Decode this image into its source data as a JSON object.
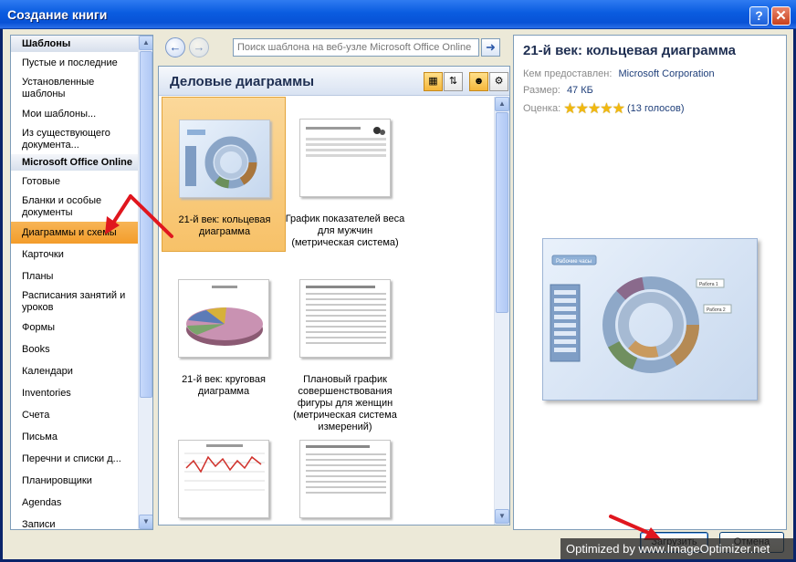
{
  "window": {
    "title": "Создание книги",
    "help_label": "?",
    "close_label": "✕"
  },
  "nav": {
    "items": [
      {
        "label": "Шаблоны",
        "type": "header"
      },
      {
        "label": "Пустые и последние",
        "type": "item"
      },
      {
        "label": "Установленные шаблоны",
        "type": "item"
      },
      {
        "label": "Мои шаблоны...",
        "type": "item"
      },
      {
        "label": "Из существующего документа...",
        "type": "item"
      },
      {
        "label": "Microsoft Office Online",
        "type": "header"
      },
      {
        "label": "Готовые",
        "type": "item"
      },
      {
        "label": "Бланки и особые документы",
        "type": "item"
      },
      {
        "label": "Диаграммы и схемы",
        "type": "item",
        "selected": true
      },
      {
        "label": "Карточки",
        "type": "item"
      },
      {
        "label": "Планы",
        "type": "item"
      },
      {
        "label": "Расписания занятий и уроков",
        "type": "item"
      },
      {
        "label": "Формы",
        "type": "item"
      },
      {
        "label": "Books",
        "type": "item"
      },
      {
        "label": "Календари",
        "type": "item"
      },
      {
        "label": "Inventories",
        "type": "item"
      },
      {
        "label": "Счета",
        "type": "item"
      },
      {
        "label": "Письма",
        "type": "item"
      },
      {
        "label": "Перечни и списки д...",
        "type": "item"
      },
      {
        "label": "Планировщики",
        "type": "item"
      },
      {
        "label": "Agendas",
        "type": "item"
      },
      {
        "label": "Записи",
        "type": "item"
      }
    ]
  },
  "search": {
    "placeholder": "Поиск шаблона на веб-узле Microsoft Office Online",
    "back_icon": "back-arrow-icon",
    "forward_icon": "forward-arrow-icon",
    "go_icon": "go-arrow-icon"
  },
  "gallery": {
    "title": "Деловые диаграммы",
    "tiles": [
      {
        "label": "21-й век: кольцевая диаграмма",
        "selected": true
      },
      {
        "label": "График показателей веса для мужчин (метрическая система)"
      },
      {
        "label": "21-й век: круговая диаграмма"
      },
      {
        "label": "Плановый график совершенствования фигуры для женщин (метрическая система измерений)"
      },
      {
        "label": ""
      },
      {
        "label": ""
      }
    ]
  },
  "preview": {
    "title": "21-й век: кольцевая диаграмма",
    "provided_by_label": "Кем предоставлен:",
    "provided_by": "Microsoft Corporation",
    "size_label": "Размер:",
    "size": "47 КБ",
    "rating_label": "Оценка:",
    "rating_stars": 5,
    "votes": "(13 голосов)",
    "image_caption": "Рабочие часы",
    "image_callout_1": "Работа 1",
    "image_callout_2": "Работа 2"
  },
  "buttons": {
    "download": "Загрузить",
    "cancel": "Отмена"
  },
  "watermark": "Optimized by www.ImageOptimizer.net",
  "colors": {
    "selection": "#f39c2a",
    "title_bar": "#0a5ce0",
    "annotation_arrow": "#e0161e"
  }
}
